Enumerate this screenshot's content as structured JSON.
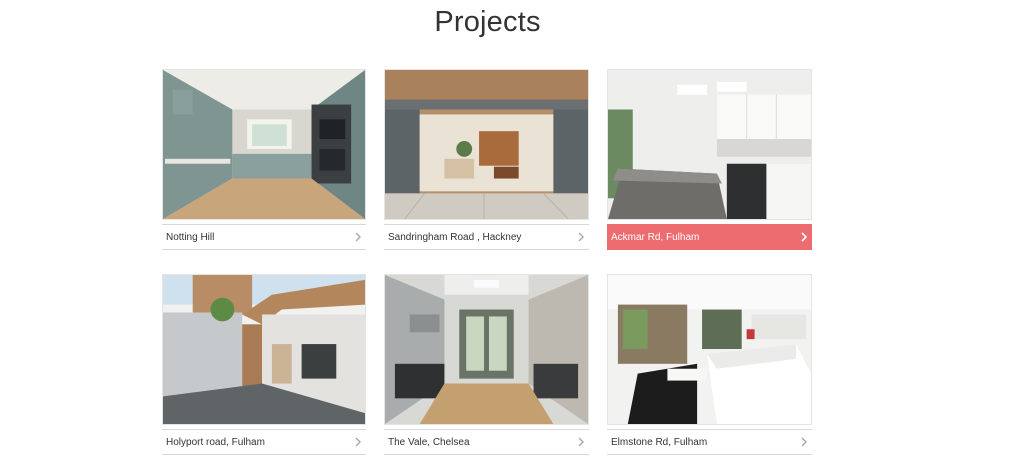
{
  "page": {
    "title": "Projects"
  },
  "projects": [
    {
      "name": "Notting Hill",
      "active": false,
      "image": "green kitchen"
    },
    {
      "name": "Sandringham Road , Hackney",
      "active": false,
      "image": "open bifold extension"
    },
    {
      "name": "Ackmar Rd, Fulham",
      "active": true,
      "image": "white kitchen with skylights"
    },
    {
      "name": "Holyport road, Fulham",
      "active": false,
      "image": "brick extension patio"
    },
    {
      "name": "The Vale, Chelsea",
      "active": false,
      "image": "galley kitchen"
    },
    {
      "name": "Elmstone Rd, Fulham",
      "active": false,
      "image": "white living room"
    }
  ],
  "colors": {
    "active_caption": "#ec6c6f",
    "text": "#333333",
    "divider": "#d8d8d8"
  },
  "icons": {
    "caption_arrow": "chevron-right-icon"
  }
}
